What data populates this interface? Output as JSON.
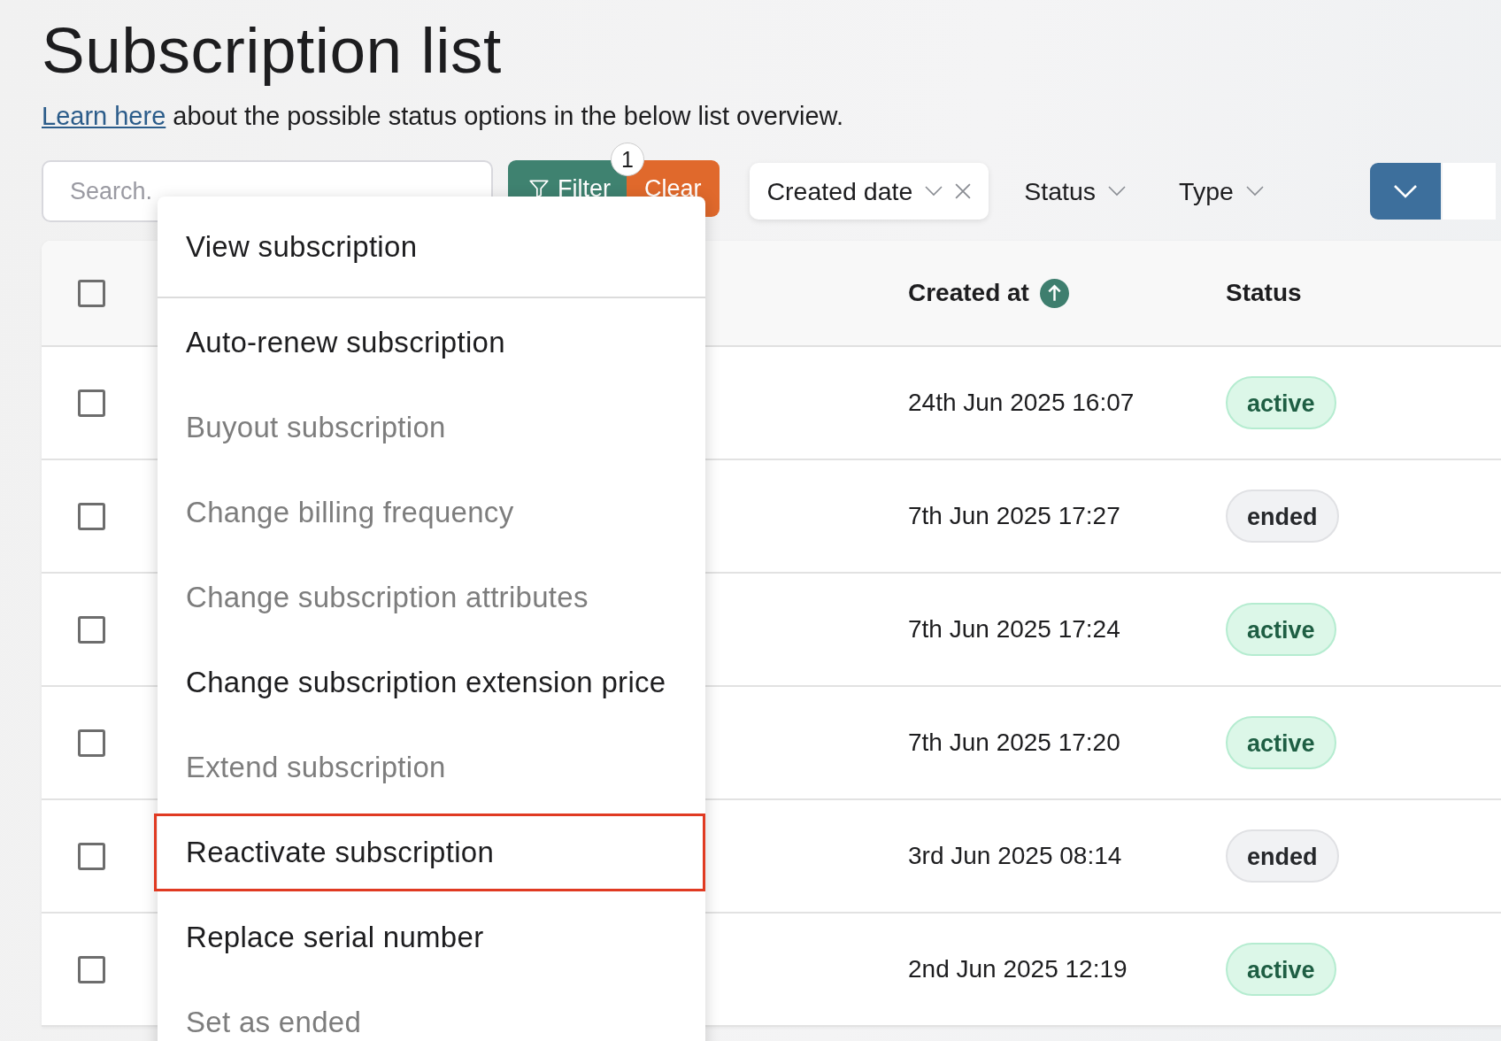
{
  "title": "Subscription list",
  "intro": {
    "link": "Learn here",
    "text": "about the possible status options in the below list overview."
  },
  "search": {
    "placeholder": "Search."
  },
  "filter_button": {
    "label": "Filter",
    "badge": "1"
  },
  "clear_button": {
    "label": "Clear"
  },
  "filters": [
    {
      "label": "Created date",
      "active": true
    },
    {
      "label": "Status",
      "active": false
    },
    {
      "label": "Type",
      "active": false
    }
  ],
  "table": {
    "select_all": {
      "checked": false
    },
    "columns": [
      {
        "label": "Created at",
        "sorted": true
      },
      {
        "label": "Status",
        "sorted": false
      }
    ],
    "rows": [
      {
        "checked": false,
        "created": "24th Jun 2025 16:07",
        "status": "active"
      },
      {
        "checked": false,
        "created": "7th Jun 2025 17:27",
        "status": "ended"
      },
      {
        "checked": false,
        "created": "7th Jun 2025 17:24",
        "status": "active"
      },
      {
        "checked": false,
        "created": "7th Jun 2025 17:20",
        "status": "active"
      },
      {
        "checked": false,
        "created": "3rd Jun 2025 08:14",
        "status": "ended"
      },
      {
        "checked": false,
        "created": "2nd Jun 2025 12:19",
        "status": "active"
      }
    ]
  },
  "menu": {
    "items": [
      {
        "label": "View subscription",
        "disabled": false,
        "highlighted": false,
        "divider_after": true
      },
      {
        "label": "Auto-renew subscription",
        "disabled": false,
        "highlighted": false,
        "divider_after": false
      },
      {
        "label": "Buyout subscription",
        "disabled": true,
        "highlighted": false,
        "divider_after": false
      },
      {
        "label": "Change billing frequency",
        "disabled": true,
        "highlighted": false,
        "divider_after": false
      },
      {
        "label": "Change subscription attributes",
        "disabled": true,
        "highlighted": false,
        "divider_after": false
      },
      {
        "label": "Change subscription extension price",
        "disabled": false,
        "highlighted": false,
        "divider_after": false
      },
      {
        "label": "Extend subscription",
        "disabled": true,
        "highlighted": false,
        "divider_after": false
      },
      {
        "label": "Reactivate subscription",
        "disabled": false,
        "highlighted": true,
        "divider_after": false
      },
      {
        "label": "Replace serial number",
        "disabled": false,
        "highlighted": false,
        "divider_after": false
      },
      {
        "label": "Set as ended",
        "disabled": true,
        "highlighted": false,
        "divider_after": false
      }
    ]
  }
}
